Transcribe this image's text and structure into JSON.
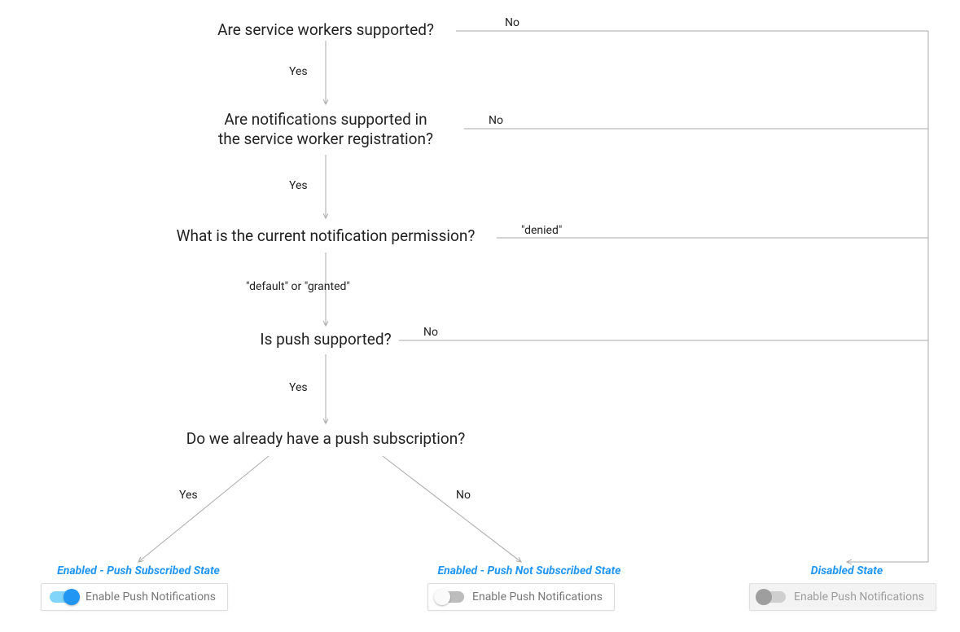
{
  "questions": {
    "q1": "Are service workers supported?",
    "q2": "Are notifications supported in\nthe service worker registration?",
    "q3": "What is the current notification permission?",
    "q4": "Is push supported?",
    "q5": "Do we already have a push subscription?"
  },
  "labels": {
    "yes": "Yes",
    "no": "No",
    "denied": "\"denied\"",
    "default_granted": "\"default\" or \"granted\""
  },
  "states": {
    "subscribed": {
      "title": "Enabled - Push Subscribed State",
      "toggle_label": "Enable Push Notifications"
    },
    "not_subscribed": {
      "title": "Enabled - Push Not Subscribed State",
      "toggle_label": "Enable Push Notifications"
    },
    "disabled": {
      "title": "Disabled State",
      "toggle_label": "Enable Push Notifications"
    }
  }
}
